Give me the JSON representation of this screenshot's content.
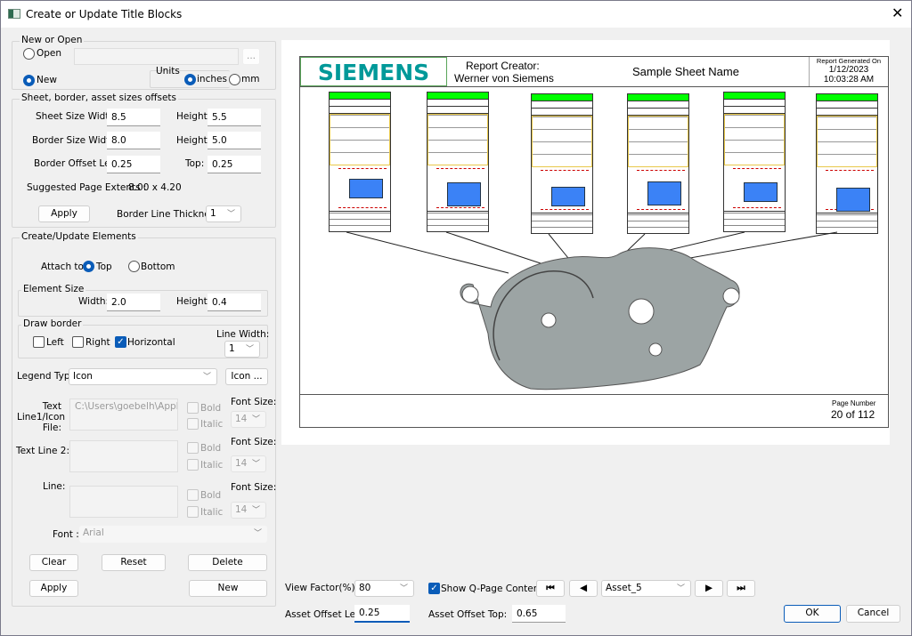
{
  "window": {
    "title": "Create or Update Title Blocks",
    "close_icon": "close-icon"
  },
  "new_open": {
    "label": "New or Open",
    "open_label": "Open",
    "new_label": "New",
    "selected": "New",
    "browse_label": "...",
    "units_label": "Units",
    "inches_label": "inches",
    "mm_label": "mm",
    "units_selected": "inches"
  },
  "sizes": {
    "label": "Sheet, border, asset sizes offsets",
    "sheet_width_label": "Sheet Size Width:",
    "sheet_width": "8.5",
    "sheet_height_label": "Height:",
    "sheet_height": "5.5",
    "border_width_label": "Border Size Width:",
    "border_width": "8.0",
    "border_height_label": "Height:",
    "border_height": "5.0",
    "offset_left_label": "Border Offset Left:",
    "offset_left": "0.25",
    "offset_top_label": "Top:",
    "offset_top": "0.25",
    "suggested_label": "Suggested Page Extents :",
    "suggested_value": "8.00 x 4.20",
    "apply_label": "Apply",
    "thickness_label": "Border Line Thickness:",
    "thickness": "1"
  },
  "elements": {
    "label": "Create/Update Elements",
    "attach_label": "Attach to:",
    "top_label": "Top",
    "bottom_label": "Bottom",
    "attach_selected": "Top",
    "size_label": "Element Size",
    "width_label": "Width:",
    "width": "2.0",
    "height_label": "Height:",
    "height": "0.4",
    "border_label": "Draw border",
    "left_label": "Left",
    "right_label": "Right",
    "horizontal_label": "Horizontal",
    "left_checked": false,
    "right_checked": false,
    "horizontal_checked": true,
    "line_width_label": "Line Width:",
    "line_width": "1",
    "legend_label": "Legend Type:",
    "legend_value": "Icon",
    "icon_button": "Icon ...",
    "text1_label": "Text Line1/Icon File:",
    "text1_value": "C:\\Users\\goebelh\\AppData\\L",
    "text2_label": "Text Line 2:",
    "text2_value": "",
    "line_label": "Line:",
    "line_value": "",
    "bold_label": "Bold",
    "italic_label": "Italic",
    "font_size_label": "Font Size:",
    "font_size": "14",
    "font_label": "Font :",
    "font_value": "Arial",
    "clear_label": "Clear",
    "reset_label": "Reset",
    "delete_label": "Delete",
    "apply_label": "Apply",
    "new_label": "New"
  },
  "preview": {
    "logo": "SIEMENS",
    "creator_label": "Report Creator:",
    "creator_name": "Werner von Siemens",
    "sheet_name": "Sample Sheet Name",
    "generated_label": "Report Generated On",
    "generated_date": "1/12/2023",
    "generated_time": "10:03:28 AM",
    "page_label": "Page Number",
    "page_value": "20 of 112",
    "logo_color": "#009999",
    "header_green": "#00ff00",
    "box_blue": "#3b82f6"
  },
  "bottom": {
    "view_factor_label": "View Factor(%)",
    "view_factor": "80",
    "show_q_label": "Show Q-Page Content",
    "show_q_checked": true,
    "asset": "Asset_5",
    "asset_left_label": "Asset Offset Left:",
    "asset_left": "0.25",
    "asset_top_label": "Asset Offset Top:",
    "asset_top": "0.65",
    "ok_label": "OK",
    "cancel_label": "Cancel"
  }
}
